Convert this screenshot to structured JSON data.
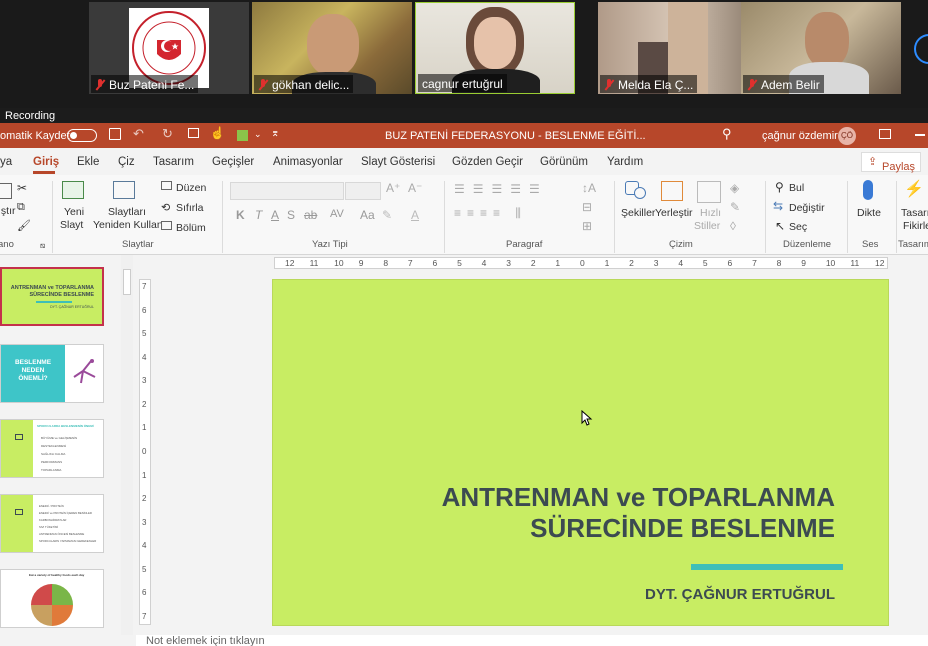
{
  "participants": [
    {
      "name": "Buz Pateni Fe...",
      "muted": true
    },
    {
      "name": "gökhan delic...",
      "muted": true
    },
    {
      "name": "cagnur ertuğrul",
      "muted": false
    },
    {
      "name": "Melda Ela Ç...",
      "muted": true
    },
    {
      "name": "Adem Belir",
      "muted": true
    }
  ],
  "logo_text": "TÜRKİYE BUZ PATENİ FEDERASYONU",
  "recording_label": "Recording",
  "titlebar": {
    "autosave": "omatik Kaydet",
    "doc_title": "BUZ PATENİ FEDERASYONU - BESLENME EĞİTİ...",
    "user": "çağnur özdemir",
    "initials": "ÇÖ"
  },
  "tabs": [
    "ya",
    "Giriş",
    "Ekle",
    "Çiz",
    "Tasarım",
    "Geçişler",
    "Animasyonlar",
    "Slayt Gösterisi",
    "Gözden Geçir",
    "Görünüm",
    "Yardım"
  ],
  "share_label": "Paylaş",
  "ribbon": {
    "paste_partial": "ıştır",
    "pano": "ano",
    "new_slide_1": "Yeni",
    "new_slide_2": "Slayt",
    "reuse_1": "Slaytları",
    "reuse_2": "Yeniden Kullan",
    "layout": "Düzen",
    "reset": "Sıfırla",
    "section": "Bölüm",
    "group_slides": "Slaytlar",
    "group_font": "Yazı Tipi",
    "group_paragraph": "Paragraf",
    "shapes": "Şekiller",
    "arrange": "Yerleştir",
    "quick_styles_1": "Hızlı",
    "quick_styles_2": "Stiller",
    "group_drawing": "Çizim",
    "find": "Bul",
    "replace": "Değiştir",
    "select": "Seç",
    "group_editing": "Düzenleme",
    "dictate": "Dikte",
    "group_voice": "Ses",
    "designer_1": "Tasarı",
    "designer_2": "Fikirle",
    "group_designer": "Tasarım"
  },
  "ruler_h": [
    "12",
    "11",
    "10",
    "9",
    "8",
    "7",
    "6",
    "5",
    "4",
    "3",
    "2",
    "1",
    "0",
    "1",
    "2",
    "3",
    "4",
    "5",
    "6",
    "7",
    "8",
    "9",
    "10",
    "11",
    "12"
  ],
  "ruler_v": [
    "7",
    "6",
    "5",
    "4",
    "3",
    "2",
    "1",
    "0",
    "1",
    "2",
    "3",
    "4",
    "5",
    "6",
    "7"
  ],
  "slide": {
    "title_line1": "ANTRENMAN ve TOPARLANMA",
    "title_line2": "SÜRECİNDE BESLENME",
    "author": "DYT. ÇAĞNUR ERTUĞRUL"
  },
  "thumbnails": {
    "t1_title": "ANTRENMAN ve TOPARLANMA SÜRECİNDE BESLENME",
    "t1_author": "DYT. ÇAĞNUR ERTUĞRUL",
    "t2_text": "BESLENME NEDEN ÖNEMLİ?",
    "t3_heading": "SPORCULARDA BESLENMENİN ÖNEMİ",
    "t3_items": [
      "BÜYÜME ve GELİŞMENİN DESTEKLENMESİ",
      "SAĞLIKLI KALMA",
      "PERFORMANS",
      "TOPARLANMA"
    ],
    "t4_items": [
      "ENERJİ / PROTEİN",
      "ENERJİ ve PROTEİN İÇEREN BESİNLER",
      "KARBONHİDRATLAR",
      "SIVI TÜKETİMİ",
      "ANTRENMAN ÖNCESİ BESLENME",
      "SPORCULARIN YAPMAMASI GEREKENLER"
    ],
    "t5_heading": "Eat a variety of healthy foods each day"
  },
  "notes_placeholder": "Not eklemek için tıklayın",
  "colors": {
    "accent": "#b7472a",
    "slide_bg": "#c8ed63",
    "title_color": "#3c4a51",
    "underline": "#3ebfb8"
  }
}
